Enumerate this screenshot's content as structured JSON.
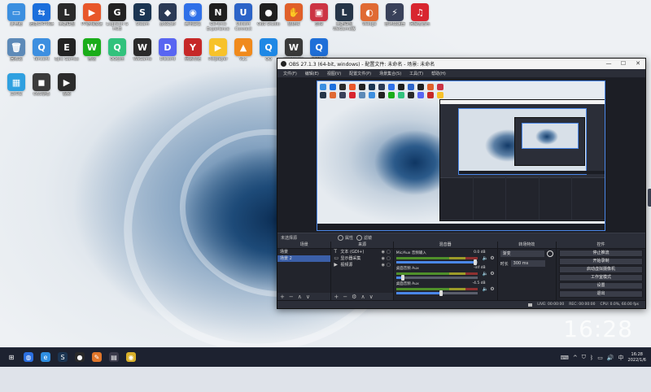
{
  "desktop": {
    "icons": [
      {
        "label": "此电脑",
        "color": "#3b8fe0",
        "glyph": "▭"
      },
      {
        "label": "迅捷文件转换",
        "color": "#1c6fdc",
        "glyph": "⇆"
      },
      {
        "label": "英雄联盟",
        "color": "#2a2a2a",
        "glyph": "L"
      },
      {
        "label": "PP游戏加速",
        "color": "#e8572a",
        "glyph": "▶"
      },
      {
        "label": "Logitech G HUB",
        "color": "#222222",
        "glyph": "G"
      },
      {
        "label": "Steam",
        "color": "#1b3552",
        "glyph": "S"
      },
      {
        "label": "云顶之弈",
        "color": "#2b3a55",
        "glyph": "◆"
      },
      {
        "label": "腾讯会议",
        "color": "#2f70e8",
        "glyph": "◉"
      },
      {
        "label": "GeForce Experience",
        "color": "#1f1f1f",
        "glyph": "N"
      },
      {
        "label": "Ubisoft Connect",
        "color": "#2c64c8",
        "glyph": "U"
      },
      {
        "label": "OBS Studio",
        "color": "#202020",
        "glyph": "●"
      },
      {
        "label": "鼠标侠",
        "color": "#e0602a",
        "glyph": "✋"
      },
      {
        "label": "剪映",
        "color": "#cc3444",
        "glyph": "▣"
      },
      {
        "label": "英雄联盟WeGame版",
        "color": "#253548",
        "glyph": "L"
      },
      {
        "label": "Wedge",
        "color": "#e06a33",
        "glyph": "◐"
      },
      {
        "label": "雷神加速器",
        "color": "#39415a",
        "glyph": "⚡"
      },
      {
        "label": "网易云音乐",
        "color": "#d8262f",
        "glyph": "♫"
      },
      {
        "label": "回收站",
        "color": "#5d8ab8",
        "glyph": "🗑"
      },
      {
        "label": "Tencent",
        "color": "#3d8fe0",
        "glyph": "Q"
      },
      {
        "label": "Epic Games",
        "color": "#222222",
        "glyph": "E"
      },
      {
        "label": "微信",
        "color": "#1aad19",
        "glyph": "W"
      },
      {
        "label": "QQ音乐",
        "color": "#31c27c",
        "glyph": "Q"
      },
      {
        "label": "WeGame",
        "color": "#2a2a2a",
        "glyph": "W"
      },
      {
        "label": "Discord",
        "color": "#5865f2",
        "glyph": "D"
      },
      {
        "label": "网易有道",
        "color": "#c62828",
        "glyph": "Y"
      },
      {
        "label": "Potplayer",
        "color": "#f7c22a",
        "glyph": "▶"
      },
      {
        "label": "VLC",
        "color": "#f08a1c",
        "glyph": "▲"
      },
      {
        "label": "QQ",
        "color": "#1e88e5",
        "glyph": "Q"
      },
      {
        "label": "Warframe",
        "color": "#3a3a3a",
        "glyph": "W"
      },
      {
        "label": "腾讯QQ",
        "color": "#1f6fd8",
        "glyph": "Q"
      },
      {
        "label": "文件夹",
        "color": "#2fa0e0",
        "glyph": "▦"
      },
      {
        "label": "OBS录像",
        "color": "#3b3b3b",
        "glyph": "◼"
      },
      {
        "label": "视频",
        "color": "#2b2b2b",
        "glyph": "▶"
      }
    ],
    "clock_watermark": "16:28"
  },
  "obs": {
    "title": "OBS 27.1.3 (64-bit, windows) - 配置文件: 未命名 - 场景: 未命名",
    "menu": [
      "文件(F)",
      "编辑(E)",
      "视图(V)",
      "配置文件(P)",
      "场景集合(S)",
      "工具(T)",
      "帮助(H)"
    ],
    "scene_bar": {
      "no_source": "未选择源",
      "properties": "属性",
      "filters": "滤镜"
    },
    "docks": {
      "scenes": {
        "header": "场景",
        "items": [
          "场景",
          "场景 2"
        ]
      },
      "sources": {
        "header": "来源",
        "items": [
          {
            "icon": "T",
            "name": "文本 (GDI+)"
          },
          {
            "icon": "▭",
            "name": "显示器采集"
          },
          {
            "icon": "▶",
            "name": "视频源"
          }
        ]
      },
      "mixer": {
        "header": "混音器",
        "channels": [
          {
            "name": "Mic/Aux 音频输入",
            "db": "0.0 dB",
            "level": 0.97
          },
          {
            "name": "桌面音频 Aux",
            "db": "-inf dB",
            "level": 0.08
          },
          {
            "name": "桌面音频 Aux",
            "db": "-4.5 dB",
            "level": 0.55
          }
        ]
      },
      "transitions": {
        "header": "转场特效",
        "type": "渐变",
        "duration_label": "时长",
        "duration": "300 ms"
      },
      "controls": {
        "header": "控件",
        "buttons": [
          "停止推流",
          "开始录制",
          "启动虚拟摄像机",
          "工作室模式",
          "设置",
          "退出"
        ]
      }
    },
    "status": {
      "live": "LIVE: 00:00:00",
      "rec": "REC: 00:00:00",
      "cpu": "CPU: 0.0%, 60.00 fps"
    }
  },
  "taskbar": {
    "apps": [
      {
        "name": "start-button",
        "color": "#1d2230",
        "glyph": "⊞"
      },
      {
        "name": "search",
        "color": "#2b6fe0",
        "glyph": "◍"
      },
      {
        "name": "browser",
        "color": "#2f8ee0",
        "glyph": "e"
      },
      {
        "name": "steam",
        "color": "#1b3552",
        "glyph": "S"
      },
      {
        "name": "obs",
        "color": "#2a2a2a",
        "glyph": "●"
      },
      {
        "name": "app-orange",
        "color": "#e0762a",
        "glyph": "✎"
      },
      {
        "name": "app-dark",
        "color": "#3a3a4a",
        "glyph": "▤"
      },
      {
        "name": "app-yellow",
        "color": "#d8b02a",
        "glyph": "◉"
      }
    ],
    "time": "16:28",
    "date": "2022/1/6"
  }
}
